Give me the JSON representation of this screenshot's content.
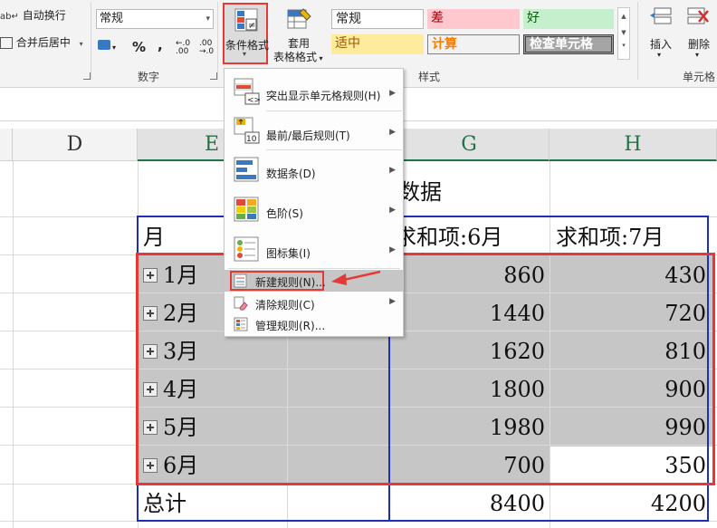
{
  "ribbon": {
    "alignment": {
      "wrap_text": "自动换行",
      "merge_center": "合并后居中"
    },
    "number": {
      "format_value": "常规",
      "percent": "%",
      "comma": ",",
      "group_label": "数字"
    },
    "conditional_format": {
      "line1": "条件格式",
      "dropdown": "▾"
    },
    "table_format": {
      "line1": "套用",
      "line2": "表格格式"
    },
    "styles": {
      "group_label": "样式",
      "cells": [
        {
          "label": "常规",
          "bg": "#ffffff",
          "fg": "#000000"
        },
        {
          "label": "差",
          "bg": "#ffc7ce",
          "fg": "#9c0006"
        },
        {
          "label": "好",
          "bg": "#c6efce",
          "fg": "#006100"
        },
        {
          "label": "适中",
          "bg": "#ffeb9c",
          "fg": "#9c5700"
        },
        {
          "label": "计算",
          "bg": "#f2f2f2",
          "fg": "#fa7d00"
        },
        {
          "label": "检查单元格",
          "bg": "#a5a5a5",
          "fg": "#ffffff"
        }
      ]
    },
    "cells_group": {
      "insert": "插入",
      "delete": "删除",
      "group_label": "单元格"
    }
  },
  "columns": [
    "D",
    "E",
    "G",
    "H"
  ],
  "sheet": {
    "title_fragment": "数据",
    "header": {
      "e": "月",
      "g": "求和项:6月",
      "h": "求和项:7月"
    },
    "rows": [
      {
        "label": "1月",
        "g": "860",
        "h": "430"
      },
      {
        "label": "2月",
        "g": "1440",
        "h": "720"
      },
      {
        "label": "3月",
        "g": "1620",
        "h": "810"
      },
      {
        "label": "4月",
        "g": "1800",
        "h": "900"
      },
      {
        "label": "5月",
        "g": "1980",
        "h": "990"
      },
      {
        "label": "6月",
        "g": "700",
        "h": "350"
      }
    ],
    "total": {
      "label": "总计",
      "g": "8400",
      "h": "4200"
    }
  },
  "menu": {
    "items": [
      {
        "label": "突出显示单元格规则(H)"
      },
      {
        "label": "最前/最后规则(T)"
      },
      {
        "label": "数据条(D)"
      },
      {
        "label": "色阶(S)"
      },
      {
        "label": "图标集(I)"
      },
      {
        "label": "新建规则(N)..."
      },
      {
        "label": "清除规则(C)"
      },
      {
        "label": "管理规则(R)..."
      }
    ]
  },
  "colors": {
    "accent_red": "#e53935",
    "selection_blue": "#1f2fb8",
    "excel_green": "#217346"
  }
}
